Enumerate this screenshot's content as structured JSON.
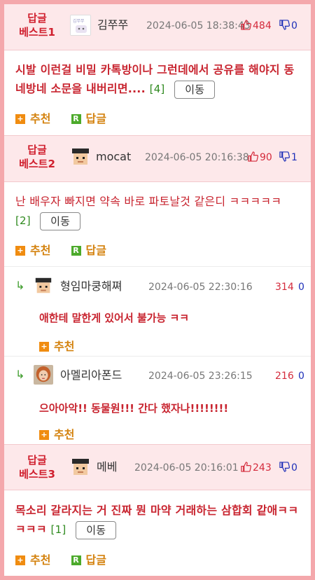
{
  "posts": [
    {
      "badge_line1": "답글",
      "badge_line2": "베스트1",
      "nickname": "김쭈쭈",
      "date": "2024-06-05 18:38:43",
      "up": "484",
      "down": "0",
      "content": "시발 이런걸 비밀 카톡방이나 그런데에서 공유를 해야지 동네방네 소문을 내버리면....",
      "reply_count": "[4]",
      "move_label": "이동",
      "recommend_label": "추천",
      "reply_label": "답글"
    },
    {
      "badge_line1": "답글",
      "badge_line2": "베스트2",
      "nickname": "mocat",
      "date": "2024-06-05 20:16:38",
      "up": "90",
      "down": "1",
      "content": "난 배우자 빠지면 약속 바로 파토날것 같은디 ㅋㅋㅋㅋㅋ",
      "reply_count": "[2]",
      "move_label": "이동",
      "recommend_label": "추천",
      "reply_label": "답글",
      "comments": [
        {
          "nickname": "형임마쿵해쪄",
          "date": "2024-06-05 22:30:16",
          "up": "314",
          "down": "0",
          "content": "애한테 말한게 있어서 불가능 ㅋㅋ",
          "recommend_label": "추천"
        },
        {
          "nickname": "아멜리아폰드",
          "date": "2024-06-05 23:26:15",
          "up": "216",
          "down": "0",
          "content": "으아아악!! 동물원!!! 간다 했자나!!!!!!!!",
          "recommend_label": "추천"
        }
      ]
    },
    {
      "badge_line1": "답글",
      "badge_line2": "베스트3",
      "nickname": "메베",
      "date": "2024-06-05 20:16:01",
      "up": "243",
      "down": "0",
      "content": "목소리 갈라지는 거 진짜 뭔 마약 거래하는 삼합회 같애ㅋㅋㅋㅋㅋ",
      "reply_count": "[1]",
      "move_label": "이동",
      "recommend_label": "추천",
      "reply_label": "답글"
    }
  ],
  "icons": {
    "thumb_up": "thumbs-up-icon",
    "thumb_down": "thumbs-down-icon",
    "plus": "plus-icon",
    "reply": "reply-r-icon",
    "reply_arrow": "reply-arrow-icon"
  },
  "colors": {
    "frame": "#f4a8ac",
    "header_bg": "#fde8ea",
    "accent_red": "#c8242f",
    "up_red": "#d42b3c",
    "down_blue": "#1d2fb8",
    "recommend_orange": "#f08c10",
    "reply_green": "#4caa2b"
  }
}
